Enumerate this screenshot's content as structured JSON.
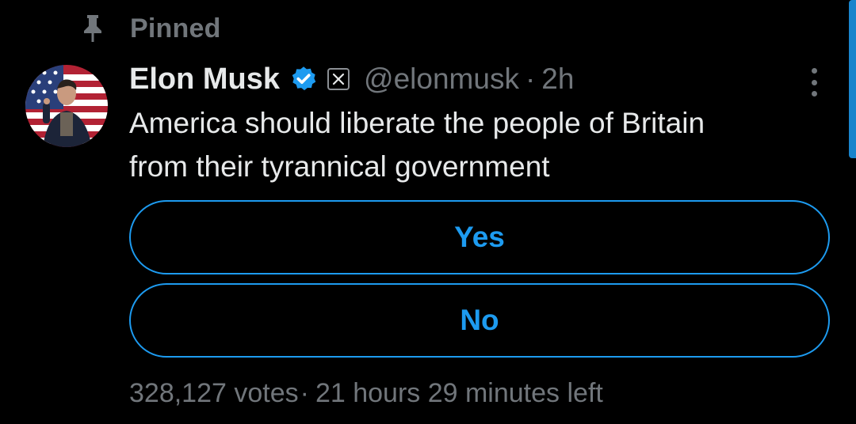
{
  "pinned": {
    "label": "Pinned",
    "icon": "pin-icon"
  },
  "author": {
    "display_name": "Elon Musk",
    "handle": "@elonmusk",
    "time": "2h",
    "separator": "·",
    "verified_icon": "verified-badge-icon",
    "affiliate_icon": "x-logo-icon"
  },
  "tweet": {
    "line1": "America should liberate the people of Britain",
    "line2": "from their tyrannical government"
  },
  "poll": {
    "options": [
      {
        "label": "Yes"
      },
      {
        "label": "No"
      }
    ],
    "votes": "328,127 votes",
    "separator": "·",
    "time_left": "21 hours 29 minutes left"
  },
  "colors": {
    "accent": "#1d9bf0",
    "background": "#000000",
    "primary_text": "#e7e9ea",
    "secondary_text": "#71767b"
  }
}
